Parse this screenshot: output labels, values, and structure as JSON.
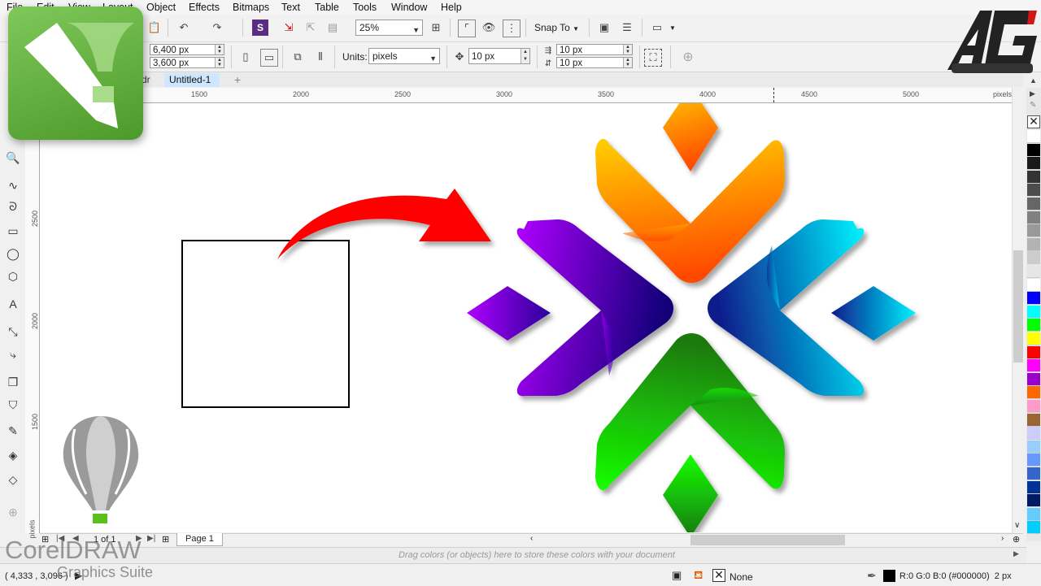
{
  "menu": [
    "File",
    "Edit",
    "View",
    "Layout",
    "Object",
    "Effects",
    "Bitmaps",
    "Text",
    "Table",
    "Tools",
    "Window",
    "Help"
  ],
  "toolbar": {
    "zoom": "25%",
    "snap_label": "Snap To",
    "width": "6,400 px",
    "height": "3,600 px",
    "units_label": "Units:",
    "units_value": "pixels",
    "nudge": "10 px",
    "dup_x": "10 px",
    "dup_y": "10 px"
  },
  "tabs": {
    "prev_fragment": "dr",
    "active": "Untitled-1",
    "add": "+"
  },
  "ruler": {
    "top_ticks": [
      "1500",
      "2000",
      "2500",
      "3000",
      "3500",
      "4000",
      "4500",
      "5000"
    ],
    "top_unit": "pixels",
    "left_ticks": [
      "2500",
      "2000",
      "1500"
    ],
    "left_unit": "pixels"
  },
  "page_nav": {
    "counter": "1 of 1",
    "page_tab": "Page 1"
  },
  "doc_palette_hint": "Drag colors (or objects) here to store these colors with your document",
  "status": {
    "coords": "( 4,333 , 3,096 )",
    "fill": "None",
    "outline": "R:0 G:0 B:0 (#000000)  2 px"
  },
  "watermark": {
    "line1": "CorelDRAW",
    "line2": "Graphics Suite"
  },
  "palette_colors": [
    "#ffffff",
    "#000000",
    "#1a1a1a",
    "#333333",
    "#4d4d4d",
    "#666666",
    "#808080",
    "#999999",
    "#b3b3b3",
    "#cccccc",
    "#e6e6e6",
    "#ffffff",
    "#0000ff",
    "#00ffff",
    "#00ff00",
    "#ffff00",
    "#ff0000",
    "#ff00ff",
    "#9900cc",
    "#ff6600",
    "#ff99cc",
    "#996633",
    "#ccccff",
    "#99ccff",
    "#6699ff",
    "#3366cc",
    "#003399",
    "#001a66",
    "#66ccff",
    "#00ccff"
  ],
  "colors": {
    "orange_top": "#ffd000",
    "orange_bottom": "#ff4a00",
    "purple": "#a000ff",
    "navy": "#12007a",
    "cyan": "#00f2ff",
    "dark_blue": "#0a1a8a",
    "green_light": "#12ff00",
    "green_dark": "#1e7a10",
    "arrow_red": "#ff0000"
  }
}
